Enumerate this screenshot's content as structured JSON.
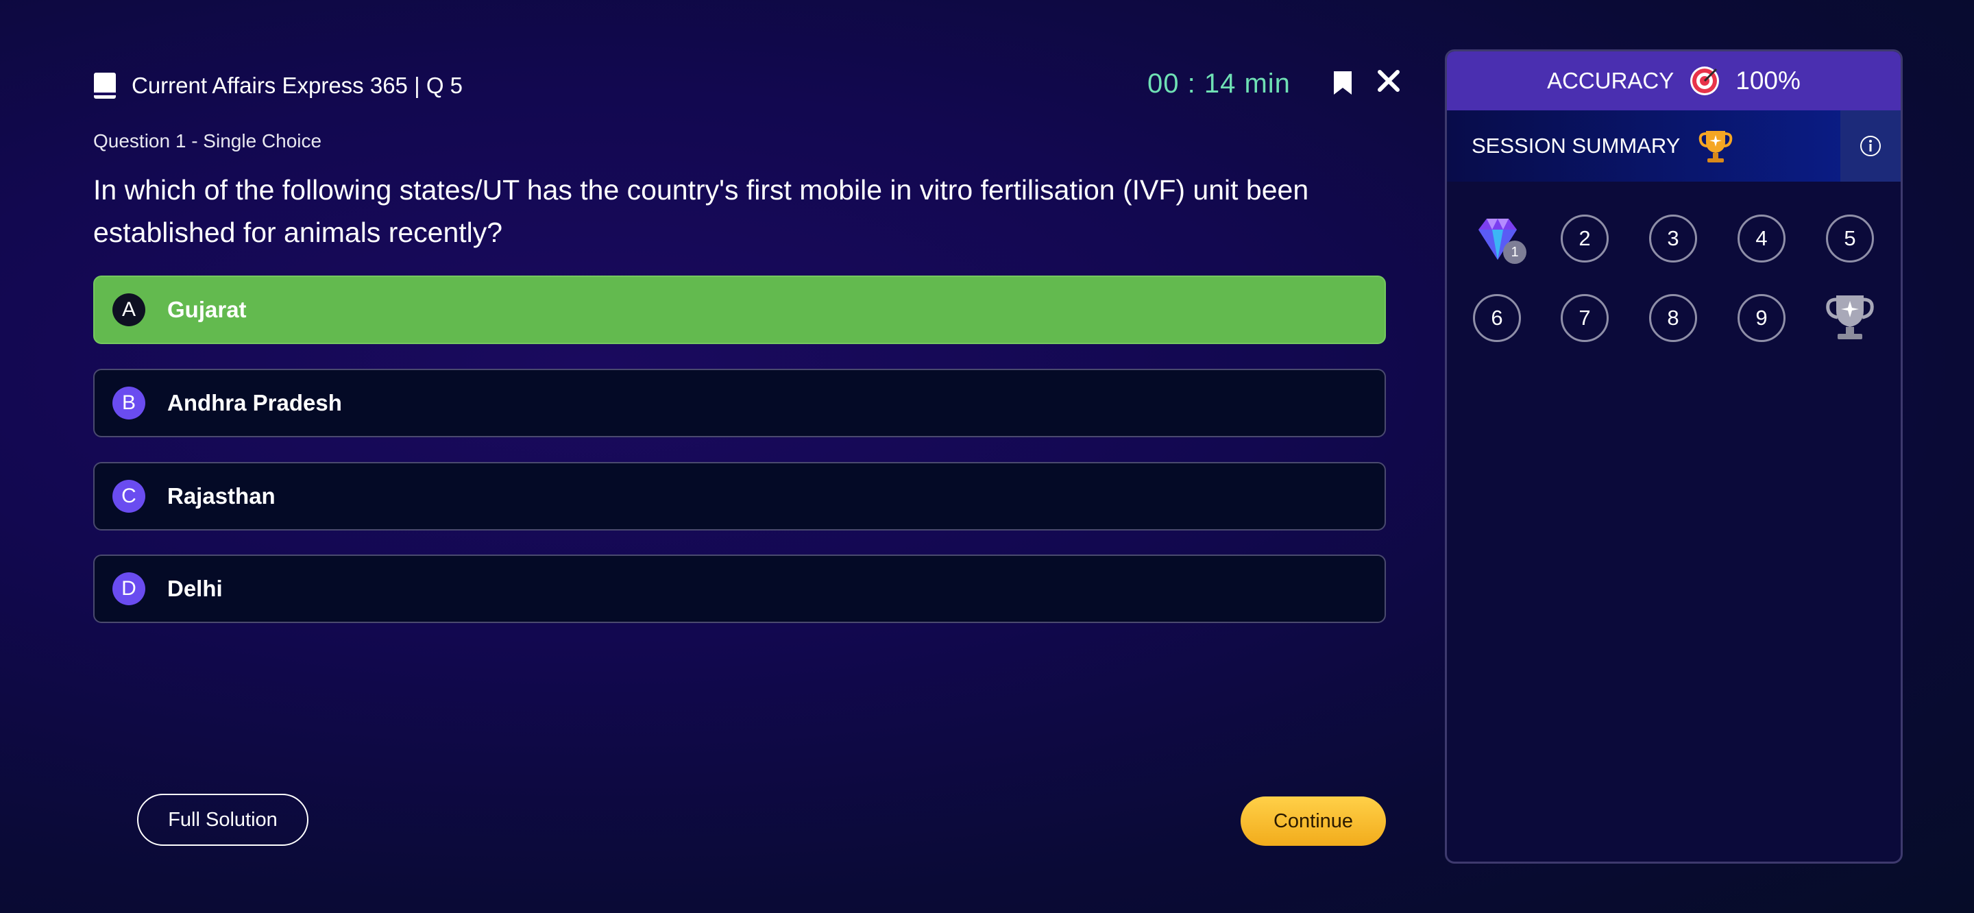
{
  "header": {
    "title": "Current Affairs Express 365 | Q 5",
    "timer": "00 : 14 min"
  },
  "question": {
    "label": "Question 1 - Single Choice",
    "text": "In which of the following states/UT has the country's first mobile in vitro fertilisation (IVF) unit been established for animals recently?"
  },
  "options": [
    {
      "letter": "A",
      "text": "Gujarat",
      "state": "correct"
    },
    {
      "letter": "B",
      "text": "Andhra Pradesh",
      "state": "default"
    },
    {
      "letter": "C",
      "text": "Rajasthan",
      "state": "default"
    },
    {
      "letter": "D",
      "text": "Delhi",
      "state": "default"
    }
  ],
  "buttons": {
    "full_solution": "Full Solution",
    "continue": "Continue"
  },
  "panel": {
    "accuracy_label": "ACCURACY",
    "accuracy_value": "100%",
    "summary_label": "SESSION SUMMARY",
    "gem_badge": "1",
    "questions": [
      "2",
      "3",
      "4",
      "5",
      "6",
      "7",
      "8",
      "9"
    ]
  },
  "colors": {
    "correct": "#63ba4f",
    "accent": "#6a4cf0",
    "timer": "#6fe0b4",
    "continue": "#f2ac1c"
  },
  "icons": [
    "book-icon",
    "bookmark-icon",
    "close-icon",
    "target-icon",
    "trophy-icon",
    "info-icon",
    "gem-icon",
    "silver-trophy-icon"
  ]
}
